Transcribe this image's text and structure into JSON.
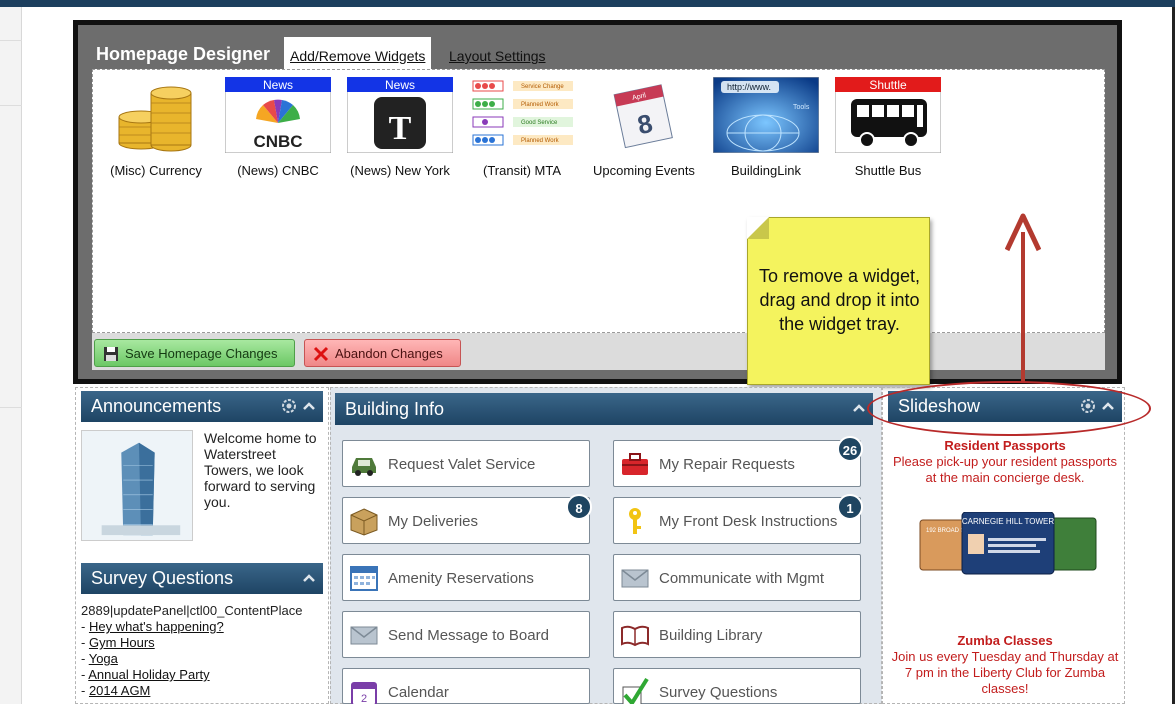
{
  "designer": {
    "title": "Homepage Designer",
    "tabs": [
      {
        "label": "Add/Remove Widgets",
        "active": true
      },
      {
        "label": "Layout Settings",
        "active": false
      }
    ],
    "widgets": [
      {
        "label": "(Misc) Currency",
        "icon": "coins-icon"
      },
      {
        "label": "(News) CNBC",
        "icon": "cnbc-logo-icon",
        "banner": "News"
      },
      {
        "label": "(News) New York",
        "icon": "nyt-logo-icon",
        "banner": "News"
      },
      {
        "label": "(Transit) MTA",
        "icon": "mta-status-icon",
        "lines": [
          "Service Change",
          "Planned Work",
          "Good Service",
          "Planned Work"
        ]
      },
      {
        "label": "Upcoming Events",
        "icon": "calendar-page-icon",
        "month": "April",
        "day": "8"
      },
      {
        "label": "BuildingLink",
        "icon": "globe-web-icon",
        "url_fragment": "http://www.",
        "tools_text": "Tools"
      },
      {
        "label": "Shuttle Bus",
        "icon": "bus-icon",
        "banner": "Shuttle"
      }
    ],
    "buttons": {
      "save": "Save Homepage Changes",
      "abandon": "Abandon Changes"
    }
  },
  "callout": {
    "text": "To remove a widget, drag and drop it into the widget tray."
  },
  "announcements": {
    "title": "Announcements",
    "text": "Welcome home to Waterstreet Towers, we look forward to serving you."
  },
  "survey": {
    "title": "Survey Questions",
    "raw_line": "2889|updatePanel|ctl00_ContentPlace",
    "items": [
      "Hey what's happening?",
      "Gym Hours",
      "Yoga",
      "Annual Holiday Party",
      "2014 AGM"
    ]
  },
  "building_info": {
    "title": "Building Info",
    "tiles": [
      {
        "label": "Request Valet Service",
        "icon": "car-icon"
      },
      {
        "label": "My Repair Requests",
        "icon": "toolbox-icon",
        "badge": "26"
      },
      {
        "label": "My Deliveries",
        "icon": "package-icon",
        "badge": "8"
      },
      {
        "label": "My Front Desk Instructions",
        "icon": "key-icon",
        "badge": "1"
      },
      {
        "label": "Amenity Reservations",
        "icon": "calendar-grid-icon"
      },
      {
        "label": "Communicate with Mgmt",
        "icon": "envelope-icon"
      },
      {
        "label": "Send Message to Board",
        "icon": "envelope-icon"
      },
      {
        "label": "Building Library",
        "icon": "book-icon"
      },
      {
        "label": "Calendar",
        "icon": "calendar-icon"
      },
      {
        "label": "Survey Questions",
        "icon": "checkmark-icon"
      }
    ]
  },
  "slideshow": {
    "title": "Slideshow",
    "slides": [
      {
        "title": "Resident Passports",
        "text": "Please pick-up your resident passports at the main concierge desk.",
        "card_text": "CARNEGIE HILL TOWER",
        "card_text_2": "192 BROAD STR"
      },
      {
        "title": "Zumba Classes",
        "text": "Join us every Tuesday and Thursday at 7 pm in the Liberty Club for Zumba classes!"
      }
    ]
  },
  "colors": {
    "header_blue": "#2a5273",
    "accent_red": "#c21d1d",
    "callout_yellow": "#f4f35e",
    "badge_navy": "#1f4561"
  }
}
